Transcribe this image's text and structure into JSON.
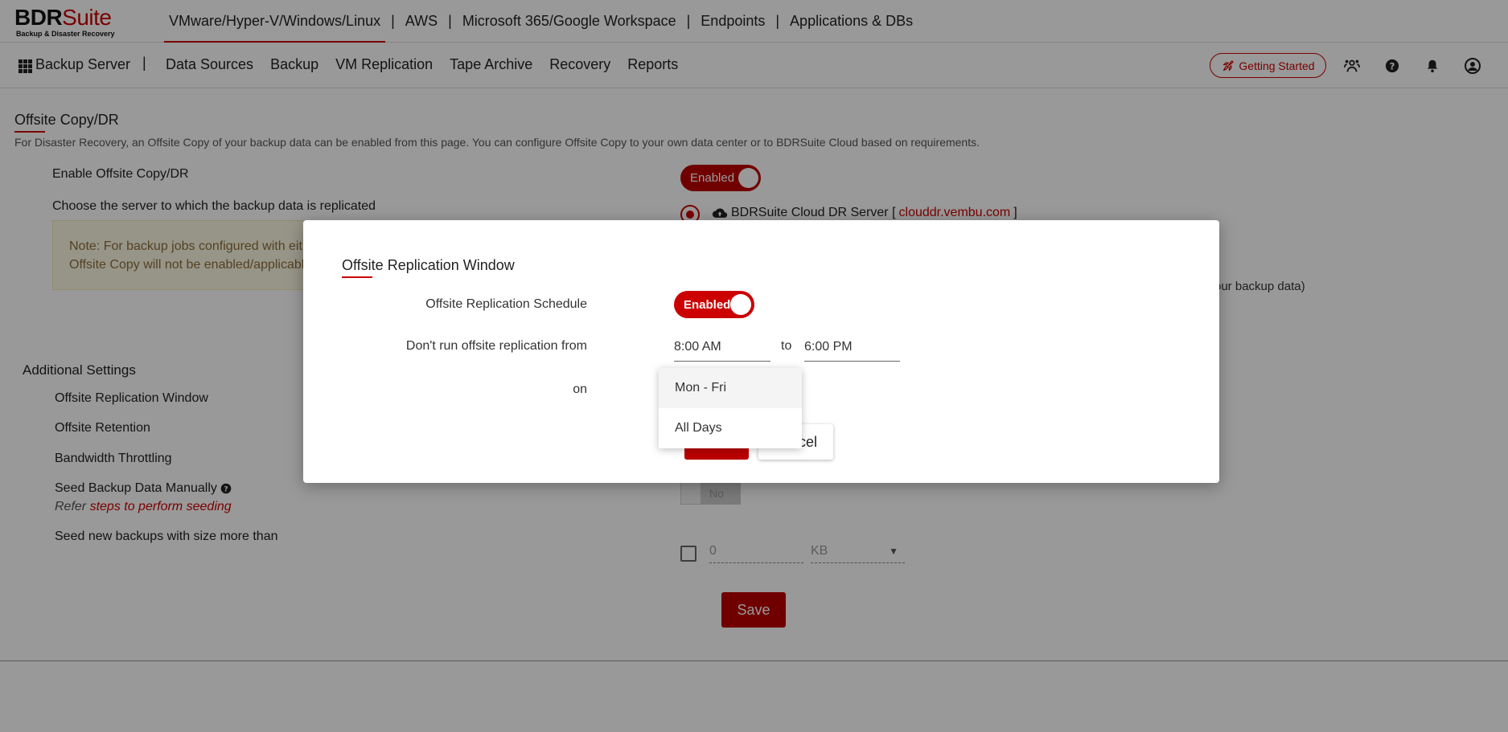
{
  "logo": {
    "bdr": "BDR",
    "suite": "Suite",
    "tagline": "Backup & Disaster Recovery"
  },
  "product_nav": [
    "VMware/Hyper-V/Windows/Linux",
    "AWS",
    "Microsoft 365/Google Workspace",
    "Endpoints",
    "Applications & DBs"
  ],
  "product_nav_separator": "|",
  "subbar": {
    "server": "Backup Server",
    "separator": "|",
    "nav": [
      "Data Sources",
      "Backup",
      "VM Replication",
      "Tape Archive",
      "Recovery",
      "Reports"
    ],
    "getting_started": "Getting Started",
    "icons": [
      "team-icon",
      "help-icon",
      "bell-icon",
      "user-icon"
    ]
  },
  "page": {
    "title": "Offsite Copy/DR",
    "description": "For Disaster Recovery, an Offsite Copy of your backup data can be enabled from this page. You can configure Offsite Copy to your own data center or to BDRSuite Cloud based on requirements.",
    "enable_label": "Enable Offsite Copy/DR",
    "enable_toggle": "Enabled",
    "server_choice_label": "Choose the server to which the backup data is replicated",
    "note_line1": "Note: For backup jobs configured with eit",
    "note_line2": "Offsite Copy will not be enabled/applicabl",
    "cloud_server_label": "BDRSuite Cloud DR Server [",
    "cloud_server_link": "clouddr.vembu.com",
    "cloud_server_close": "]",
    "right_fragment": "our backup data)",
    "additional_title": "Additional Settings",
    "additional_items": [
      "Offsite Replication Window",
      "Offsite Retention",
      "Bandwidth Throttling"
    ],
    "seed_manually": "Seed Backup Data Manually",
    "refer_text": "Refer",
    "refer_link": "steps to perform seeding",
    "seed_toggle": "No",
    "seed_new_label": "Seed new backups with size more than",
    "seed_size_value": "0",
    "seed_unit": "KB",
    "save": "Save"
  },
  "modal": {
    "title": "Offsite Replication Window",
    "schedule_label": "Offsite Replication Schedule",
    "schedule_toggle": "Enabled",
    "dont_run_label": "Don't run offsite replication from",
    "from_time": "8:00 AM",
    "to_label": "to",
    "to_time": "6:00 PM",
    "on_label": "on",
    "cancel_partial": "cel",
    "dropdown_options": [
      "Mon - Fri",
      "All Days"
    ]
  },
  "colors": {
    "accent": "#cc0000",
    "overlay": "rgba(0,0,0,0.4)"
  }
}
